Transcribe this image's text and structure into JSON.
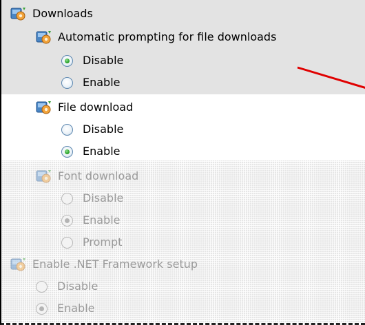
{
  "tree": {
    "downloads": {
      "label": "Downloads",
      "icon": "policy-gear-icon"
    },
    "auto_prompt": {
      "label": "Automatic prompting for file downloads",
      "icon": "policy-gear-icon",
      "options": [
        {
          "label": "Disable",
          "checked": true
        },
        {
          "label": "Enable",
          "checked": false
        }
      ]
    },
    "file_download": {
      "label": "File download",
      "icon": "policy-gear-icon",
      "options": [
        {
          "label": "Disable",
          "checked": false
        },
        {
          "label": "Enable",
          "checked": true
        }
      ]
    },
    "font_download": {
      "label": "Font download",
      "icon": "policy-gear-icon",
      "disabled": true,
      "options": [
        {
          "label": "Disable",
          "checked": false
        },
        {
          "label": "Enable",
          "checked": true
        },
        {
          "label": "Prompt",
          "checked": false
        }
      ]
    },
    "dotnet_setup": {
      "label": "Enable .NET Framework setup",
      "icon": "policy-gear-icon",
      "disabled": true,
      "options": [
        {
          "label": "Disable",
          "checked": false
        },
        {
          "label": "Enable",
          "checked": true
        }
      ]
    }
  },
  "annotation": {
    "arrow_color": "#e00000"
  },
  "colors": {
    "selected_band": "#e3e3e3",
    "disabled_text": "#9a9a9a",
    "radio_dot": "#2aa32a"
  }
}
